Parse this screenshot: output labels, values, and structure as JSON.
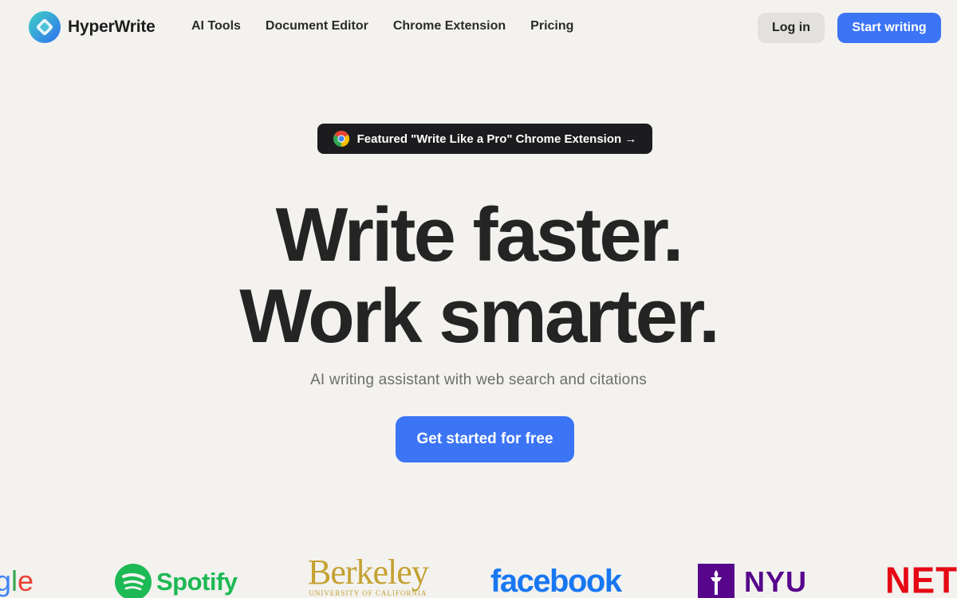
{
  "brand": {
    "name": "HyperWrite"
  },
  "nav": {
    "items": [
      "AI Tools",
      "Document Editor",
      "Chrome Extension",
      "Pricing"
    ]
  },
  "header": {
    "login_label": "Log in",
    "start_label": "Start writing"
  },
  "badge": {
    "label": "Featured \"Write Like a Pro\" Chrome Extension →"
  },
  "hero": {
    "line1": "Write faster.",
    "line2": "Work smarter.",
    "subtitle": "AI writing assistant with web search and citations",
    "cta_label": "Get started for free"
  },
  "logos": {
    "google_partial": [
      "g",
      "l",
      "e"
    ],
    "spotify": "Spotify",
    "berkeley": "Berkeley",
    "berkeley_sub": "UNIVERSITY OF CALIFORNIA",
    "facebook": "facebook",
    "nyu": "NYU",
    "netflix_partial": "NETF"
  },
  "colors": {
    "background": "#f3f2ef",
    "accent": "#3b74f5",
    "badge_bg": "#1c1c1e",
    "heading": "#242424"
  }
}
